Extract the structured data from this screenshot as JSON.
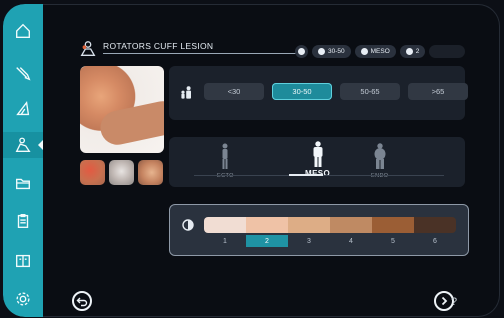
{
  "sidebar": {
    "items": [
      {
        "name": "home-icon",
        "active": false
      },
      {
        "name": "scalpel-icon",
        "active": false
      },
      {
        "name": "triangle-ruler-icon",
        "active": false
      },
      {
        "name": "patient-icon",
        "active": true
      },
      {
        "name": "folder-icon",
        "active": false
      },
      {
        "name": "clipboard-icon",
        "active": false
      },
      {
        "name": "compare-icon",
        "active": false
      },
      {
        "name": "settings-icon",
        "active": false
      }
    ]
  },
  "header": {
    "title": "ROTATORS CUFF LESION",
    "pills": [
      {
        "icon": "eye-icon",
        "label": ""
      },
      {
        "icon": "age-group-icon",
        "label": "30-50"
      },
      {
        "icon": "body-type-icon",
        "label": "MESO"
      },
      {
        "icon": "skin-tone-icon",
        "label": "2"
      },
      {
        "icon": "toggle-icon",
        "label": ""
      }
    ]
  },
  "age": {
    "options": [
      "<30",
      "30-50",
      "50-65",
      ">65"
    ],
    "selected": "30-50"
  },
  "body_type": {
    "options": [
      {
        "label": "ECTO"
      },
      {
        "label": "MESO"
      },
      {
        "label": "ENDO"
      }
    ],
    "selected": "MESO"
  },
  "skin": {
    "swatches": [
      "#f1ddd3",
      "#efc2a6",
      "#ddad86",
      "#bf8a63",
      "#9b5e35",
      "#4a3226"
    ],
    "numbers": [
      "1",
      "2",
      "3",
      "4",
      "5",
      "6"
    ],
    "selected": "2"
  },
  "colors": {
    "accent": "#1fa2b3",
    "panel": "#1b212b"
  }
}
